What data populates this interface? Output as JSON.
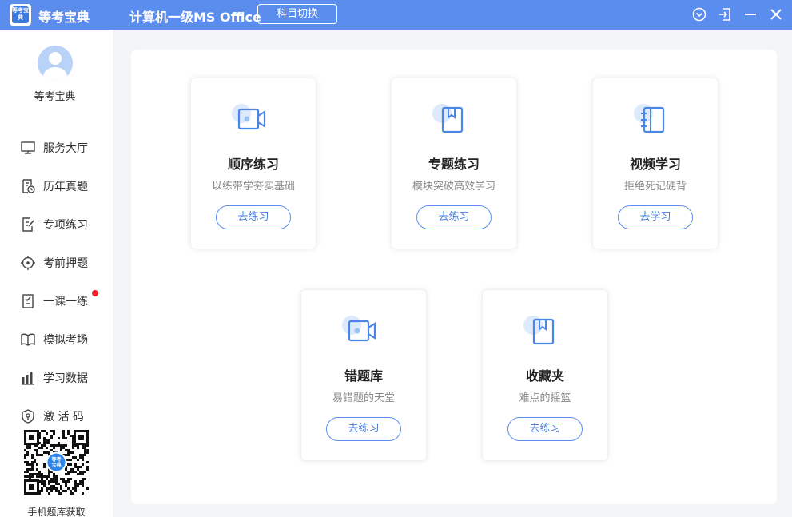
{
  "titlebar": {
    "logo_text": "等考宝典",
    "app_name": "等考宝典",
    "subject": "计算机一级MS Office",
    "switch_label": "科目切换",
    "icons": [
      "chevron-down-circle-icon",
      "exit-icon",
      "minimize-icon",
      "close-icon"
    ]
  },
  "sidebar": {
    "username": "等考宝典",
    "items": [
      {
        "label": "服务大厅",
        "icon": "monitor-icon"
      },
      {
        "label": "历年真题",
        "icon": "exam-history-icon"
      },
      {
        "label": "专项练习",
        "icon": "edit-doc-icon"
      },
      {
        "label": "考前押题",
        "icon": "target-icon"
      },
      {
        "label": "一课一练",
        "icon": "checklist-icon",
        "badge": true
      },
      {
        "label": "模拟考场",
        "icon": "book-open-icon"
      },
      {
        "label": "学习数据",
        "icon": "bar-chart-icon"
      },
      {
        "label": "激 活 码",
        "icon": "shield-icon"
      }
    ],
    "qr_caption": "手机题库获取",
    "qr_logo_text": "等考宝典"
  },
  "cards": [
    {
      "title": "顺序练习",
      "desc": "以练带学夯实基础",
      "button": "去练习",
      "icon": "video-camera-icon"
    },
    {
      "title": "专题练习",
      "desc": "模块突破高效学习",
      "button": "去练习",
      "icon": "bookmark-book-icon"
    },
    {
      "title": "视频学习",
      "desc": "拒绝死记硬背",
      "button": "去学习",
      "icon": "notebook-icon"
    },
    {
      "title": "错题库",
      "desc": "易错题的天堂",
      "button": "去练习",
      "icon": "video-camera-icon"
    },
    {
      "title": "收藏夹",
      "desc": "难点的摇篮",
      "button": "去练习",
      "icon": "bookmark-book-icon"
    }
  ],
  "colors": {
    "titlebar": "#5b8def",
    "accent": "#4a7fe0",
    "badge": "#f5222d"
  }
}
